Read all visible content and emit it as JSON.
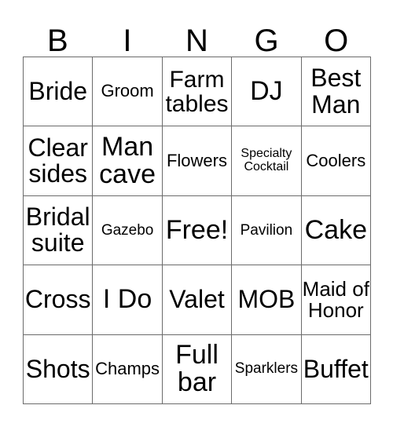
{
  "card": {
    "header_letters": [
      "B",
      "I",
      "N",
      "G",
      "O"
    ],
    "rows": [
      [
        {
          "label": "Bride",
          "size": "fs-xl"
        },
        {
          "label": "Groom",
          "size": "fs-sm"
        },
        {
          "label": "Farm\ntables",
          "size": "fs-lg"
        },
        {
          "label": "DJ",
          "size": "fs-xxl"
        },
        {
          "label": "Best\nMan",
          "size": "fs-xl"
        }
      ],
      [
        {
          "label": "Clear\nsides",
          "size": "fs-xl"
        },
        {
          "label": "Man\ncave",
          "size": "fs-xxl"
        },
        {
          "label": "Flowers",
          "size": "fs-sm"
        },
        {
          "label": "Specialty\nCocktail",
          "size": "fs-xxs"
        },
        {
          "label": "Coolers",
          "size": "fs-sm"
        }
      ],
      [
        {
          "label": "Bridal\nsuite",
          "size": "fs-xl"
        },
        {
          "label": "Gazebo",
          "size": "fs-xs"
        },
        {
          "label": "Free!",
          "size": "fs-xxl"
        },
        {
          "label": "Pavilion",
          "size": "fs-xs"
        },
        {
          "label": "Cake",
          "size": "fs-xxl"
        }
      ],
      [
        {
          "label": "Cross",
          "size": "fs-xl"
        },
        {
          "label": "I Do",
          "size": "fs-xxl"
        },
        {
          "label": "Valet",
          "size": "fs-xl"
        },
        {
          "label": "MOB",
          "size": "fs-xl"
        },
        {
          "label": "Maid of\nHonor",
          "size": "fs-md"
        }
      ],
      [
        {
          "label": "Shots",
          "size": "fs-xl"
        },
        {
          "label": "Champs",
          "size": "fs-sm"
        },
        {
          "label": "Full\nbar",
          "size": "fs-xxl"
        },
        {
          "label": "Sparklers",
          "size": "fs-xs"
        },
        {
          "label": "Buffet",
          "size": "fs-xl"
        }
      ]
    ],
    "free_space": {
      "row": 2,
      "col": 2,
      "label": "Free!"
    },
    "colors": {
      "text": "#000000",
      "grid_line": "#6b6b6b",
      "background": "#ffffff"
    }
  }
}
